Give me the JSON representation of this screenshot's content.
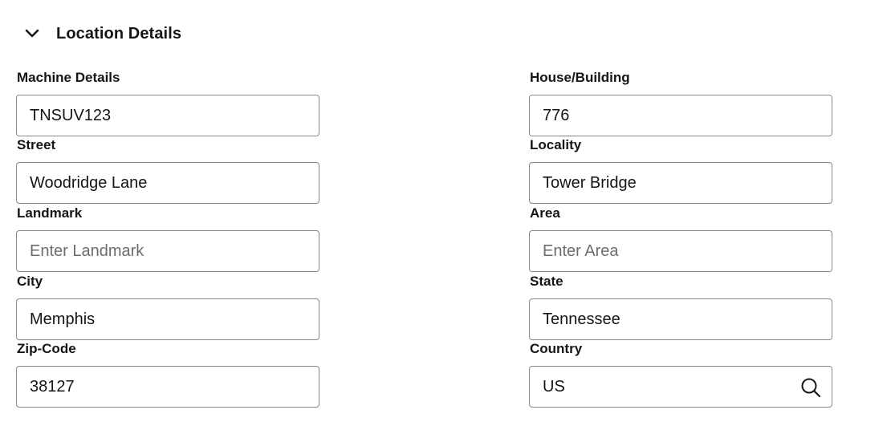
{
  "section": {
    "title": "Location Details",
    "chevron_icon": "chevron-down-icon"
  },
  "fields": {
    "machine_details": {
      "label": "Machine Details",
      "value": "TNSUV123",
      "placeholder": ""
    },
    "house_building": {
      "label": "House/Building",
      "value": "776",
      "placeholder": ""
    },
    "street": {
      "label": "Street",
      "value": "Woodridge Lane",
      "placeholder": ""
    },
    "locality": {
      "label": "Locality",
      "value": "Tower Bridge",
      "placeholder": ""
    },
    "landmark": {
      "label": "Landmark",
      "value": "",
      "placeholder": "Enter Landmark"
    },
    "area": {
      "label": "Area",
      "value": "",
      "placeholder": "Enter Area"
    },
    "city": {
      "label": "City",
      "value": "Memphis",
      "placeholder": ""
    },
    "state": {
      "label": "State",
      "value": "Tennessee",
      "placeholder": ""
    },
    "zip_code": {
      "label": "Zip-Code",
      "value": "38127",
      "placeholder": ""
    },
    "country": {
      "label": "Country",
      "value": "US",
      "placeholder": "",
      "icon": "search-icon"
    }
  },
  "colors": {
    "text": "#161513",
    "border": "#8a8783",
    "placeholder": "#6f6c68",
    "background": "#ffffff"
  }
}
